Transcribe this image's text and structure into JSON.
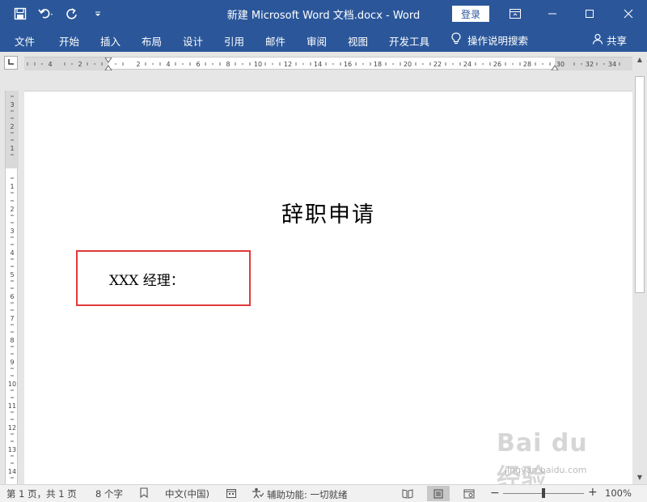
{
  "window": {
    "title": "新建 Microsoft Word 文档.docx  -  Word",
    "signin_label": "登录"
  },
  "quick_access": {
    "icons": [
      "save-icon",
      "undo-icon",
      "redo-icon",
      "customize-qat-icon"
    ]
  },
  "ribbon": {
    "tabs": [
      {
        "label": "文件"
      },
      {
        "label": "开始"
      },
      {
        "label": "插入"
      },
      {
        "label": "布局"
      },
      {
        "label": "设计"
      },
      {
        "label": "引用"
      },
      {
        "label": "邮件"
      },
      {
        "label": "审阅"
      },
      {
        "label": "视图"
      },
      {
        "label": "开发工具"
      }
    ],
    "tell_me": "操作说明搜索",
    "share": "共享"
  },
  "document": {
    "title": "辞职申请",
    "salutation": "XXX 经理："
  },
  "status_bar": {
    "page_info": "第 1 页，共 1 页",
    "word_count": "8 个字",
    "language": "中文(中国)",
    "accessibility": "辅助功能: 一切就绪",
    "zoom": "100%",
    "zoom_fraction": 0.5
  },
  "watermark": {
    "logo": "Bai du 经验",
    "url": "jingyan.baidu.com"
  },
  "colors": {
    "title_bar": "#2b579a",
    "highlight_box": "#e03a3a"
  }
}
